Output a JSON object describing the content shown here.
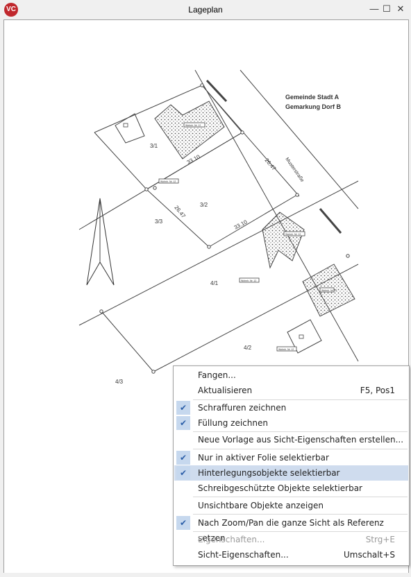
{
  "window": {
    "title": "Lageplan",
    "logo": "VC",
    "minimize_icon": "—",
    "maximize_icon": "☐",
    "close_icon": "✕"
  },
  "plan": {
    "municipality": "Gemeinde Stadt A",
    "district": "Gemarkung Dorf B",
    "street": "Musterstraße",
    "parcels": [
      "3/1",
      "3/2",
      "3/3",
      "4/1",
      "4/2",
      "4/3"
    ],
    "dimensions": [
      "33.10",
      "26.47",
      "26.47",
      "33.10"
    ],
    "building_label": "Wohnh. Nr. 12"
  },
  "context_menu": {
    "items": [
      {
        "label": "Fangen...",
        "shortcut": "",
        "checked": false,
        "disabled": false,
        "highlighted": false
      },
      {
        "label": "Aktualisieren",
        "shortcut": "F5, Pos1",
        "checked": false,
        "disabled": false,
        "highlighted": false
      },
      {
        "label": "Schraffuren zeichnen",
        "shortcut": "",
        "checked": true,
        "disabled": false,
        "highlighted": false
      },
      {
        "label": "Füllung zeichnen",
        "shortcut": "",
        "checked": true,
        "disabled": false,
        "highlighted": false
      },
      {
        "label": "Neue Vorlage aus Sicht-Eigenschaften erstellen...",
        "shortcut": "",
        "checked": false,
        "disabled": false,
        "highlighted": false
      },
      {
        "label": "Nur in aktiver Folie selektierbar",
        "shortcut": "",
        "checked": true,
        "disabled": false,
        "highlighted": false
      },
      {
        "label": "Hinterlegungsobjekte selektierbar",
        "shortcut": "",
        "checked": true,
        "disabled": false,
        "highlighted": true
      },
      {
        "label": "Schreibgeschützte Objekte selektierbar",
        "shortcut": "",
        "checked": false,
        "disabled": false,
        "highlighted": false
      },
      {
        "label": "Unsichtbare Objekte anzeigen",
        "shortcut": "",
        "checked": false,
        "disabled": false,
        "highlighted": false
      },
      {
        "label": "Nach Zoom/Pan die ganze Sicht als Referenz setzen",
        "shortcut": "",
        "checked": true,
        "disabled": false,
        "highlighted": false
      },
      {
        "label": "Eigenschaften...",
        "shortcut": "Strg+E",
        "checked": false,
        "disabled": true,
        "highlighted": false
      },
      {
        "label": "Sicht-Eigenschaften...",
        "shortcut": "Umschalt+S",
        "checked": false,
        "disabled": false,
        "highlighted": false
      }
    ],
    "check_icon": "✔"
  }
}
